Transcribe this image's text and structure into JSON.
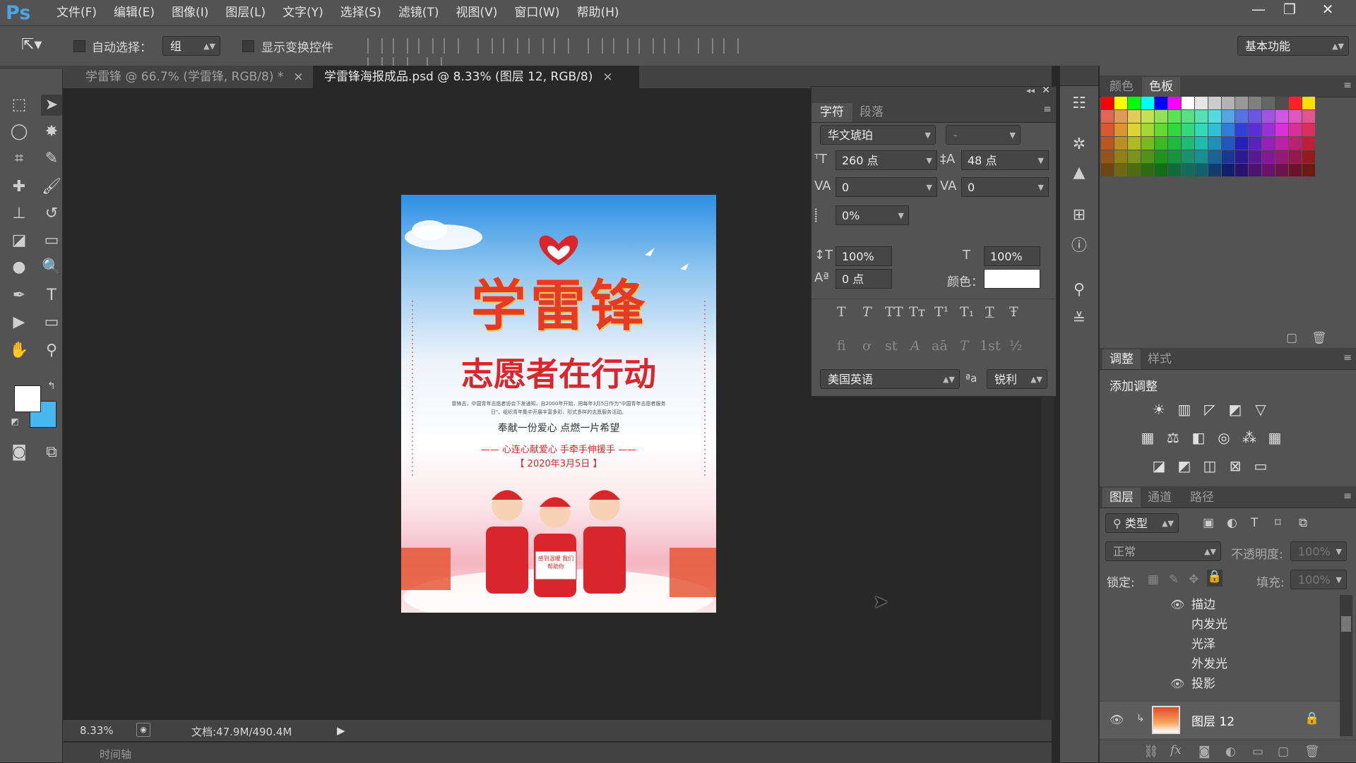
{
  "app": {
    "logo": "Ps"
  },
  "menu": [
    "文件(F)",
    "编辑(E)",
    "图像(I)",
    "图层(L)",
    "文字(Y)",
    "选择(S)",
    "滤镜(T)",
    "视图(V)",
    "窗口(W)",
    "帮助(H)"
  ],
  "window_controls": {
    "minimize": "—",
    "restore": "❐",
    "close": "✕"
  },
  "options_bar": {
    "auto_select_label": "自动选择：",
    "auto_select_value": "组",
    "show_transform_label": "显示变换控件",
    "workspace": "基本功能"
  },
  "tabs": [
    {
      "label": "学雷锋 @ 66.7% (学雷锋, RGB/8) *",
      "close": "×",
      "active": false
    },
    {
      "label": "学雷锋海报成品.psd @ 8.33% (图层 12, RGB/8)",
      "close": "×",
      "active": true
    }
  ],
  "poster": {
    "title": "学雷锋",
    "subtitle": "志愿者在行动",
    "slogan": "奉献一份爱心 点燃一片希望",
    "line2": "—— 心连心献爱心  手牵手伸援手 ——",
    "date": "【 2020年3月5日 】",
    "body_text": "雷锋志，中国青年志愿者协会下发通知，自2000年开始，把每年3月5日作为\"中国青年志愿者服务日\"，组织青年集中开展丰富多彩、形式多样的志愿服务活动。",
    "sign": "感到温暖 我们帮助你"
  },
  "status": {
    "zoom": "8.33%",
    "doc": "文档:47.9M/490.4M",
    "timeline": "时间轴"
  },
  "character_panel": {
    "tabs": [
      "字符",
      "段落"
    ],
    "font_family": "华文琥珀",
    "font_style": "-",
    "font_size": "260 点",
    "leading": "48 点",
    "kerning": "0",
    "tracking": "0",
    "scale_pct": "0%",
    "vertical_scale": "100%",
    "horizontal_scale": "100%",
    "baseline_shift": "0 点",
    "color_label": "颜色：",
    "text_color": "#ffffff",
    "style_buttons": [
      "T",
      "T",
      "TT",
      "Tт",
      "T¹",
      "T₁",
      "T",
      "Ŧ"
    ],
    "opentype_buttons": [
      "fi",
      "ơ",
      "st",
      "A",
      "aā",
      "T",
      "1st",
      "½"
    ],
    "language": "美国英语",
    "aa_label": "ªa",
    "antialias": "锐利"
  },
  "swatch_panel": {
    "tabs": [
      "颜色",
      "色板"
    ]
  },
  "adjustments_panel": {
    "tabs": [
      "调整",
      "样式"
    ],
    "title": "添加调整"
  },
  "layers_panel": {
    "tabs": [
      "图层",
      "通道",
      "路径"
    ],
    "filter_kind": "类型",
    "blend_mode": "正常",
    "opacity_label": "不透明度:",
    "opacity": "100%",
    "lock_label": "锁定:",
    "fill_label": "填充:",
    "fill": "100%",
    "effects": [
      {
        "name": "描边",
        "visible": true
      },
      {
        "name": "内发光",
        "visible": false
      },
      {
        "name": "光泽",
        "visible": false
      },
      {
        "name": "外发光",
        "visible": false
      },
      {
        "name": "投影",
        "visible": true
      }
    ],
    "layer_name": "图层 12"
  },
  "colors": {
    "accent_blue": "#4aa3e6",
    "fg_color": "#ffffff",
    "bg_color": "#46b7ef",
    "poster_red": "#d9262c"
  }
}
